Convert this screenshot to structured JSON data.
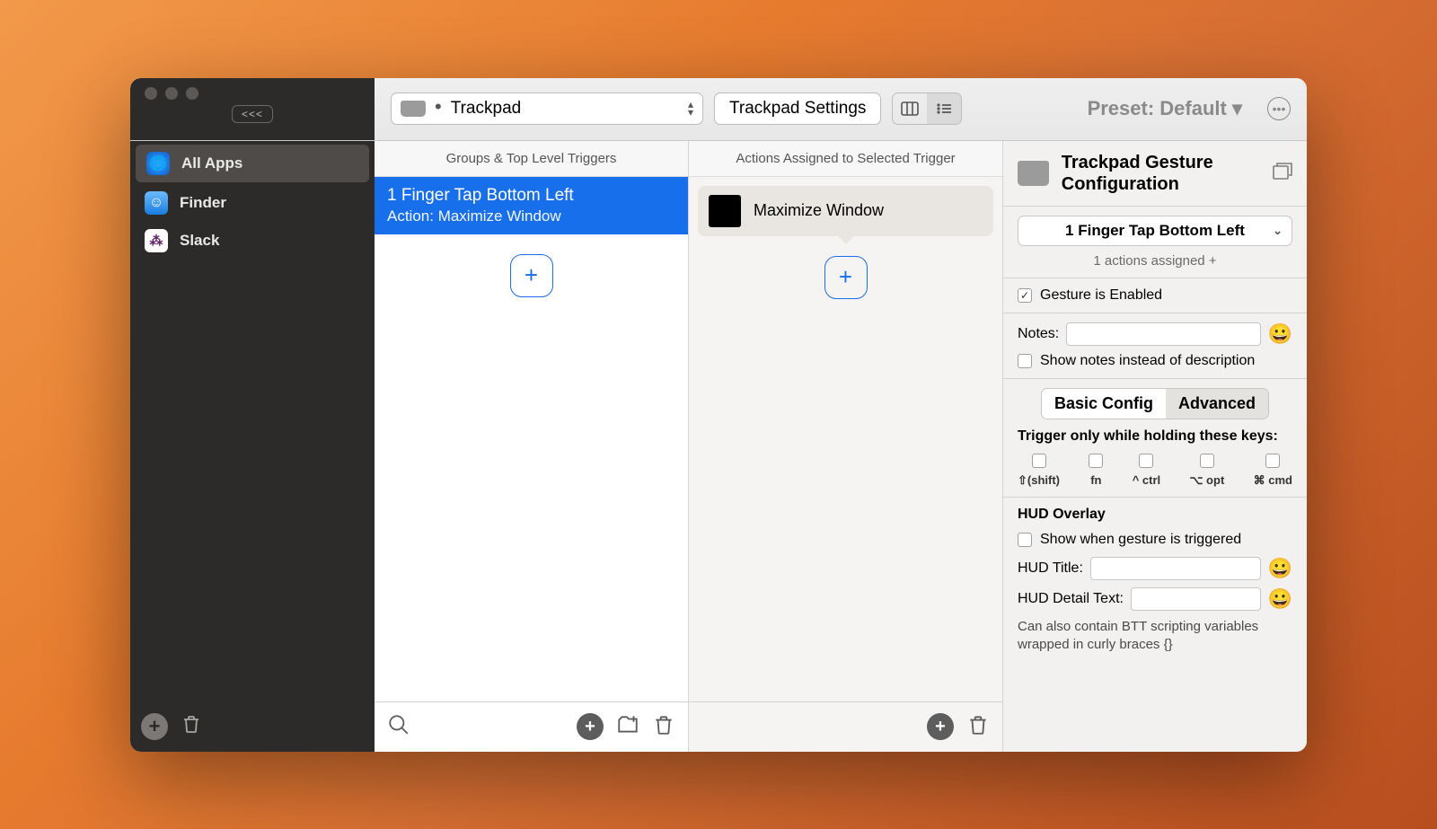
{
  "toolbar": {
    "collapse": "<<<",
    "device_label": "Trackpad",
    "settings_label": "Trackpad Settings",
    "preset_label": "Preset: Default ▾"
  },
  "sidebar": {
    "items": [
      {
        "label": "All Apps"
      },
      {
        "label": "Finder"
      },
      {
        "label": "Slack"
      }
    ]
  },
  "triggers_col": {
    "header": "Groups & Top Level Triggers",
    "rows": [
      {
        "title": "1 Finger Tap Bottom Left",
        "subtitle": "Action: Maximize Window"
      }
    ]
  },
  "actions_col": {
    "header": "Actions Assigned to Selected Trigger",
    "rows": [
      {
        "label": "Maximize Window"
      }
    ]
  },
  "inspector": {
    "title": "Trackpad Gesture Configuration",
    "dropdown_value": "1 Finger Tap Bottom Left",
    "assigned_text": "1 actions assigned +",
    "enabled_label": "Gesture is Enabled",
    "notes_label": "Notes:",
    "show_notes_label": "Show notes instead of description",
    "tab_basic": "Basic Config",
    "tab_adv": "Advanced",
    "mods_header": "Trigger only while holding these keys:",
    "mods": [
      "⇧(shift)",
      "fn",
      "^ ctrl",
      "⌥ opt",
      "⌘ cmd"
    ],
    "hud_header": "HUD Overlay",
    "show_hud_label": "Show when gesture is triggered",
    "hud_title_label": "HUD Title:",
    "hud_detail_label": "HUD Detail Text:",
    "hud_note": "Can also contain BTT scripting variables wrapped in curly braces {}"
  }
}
